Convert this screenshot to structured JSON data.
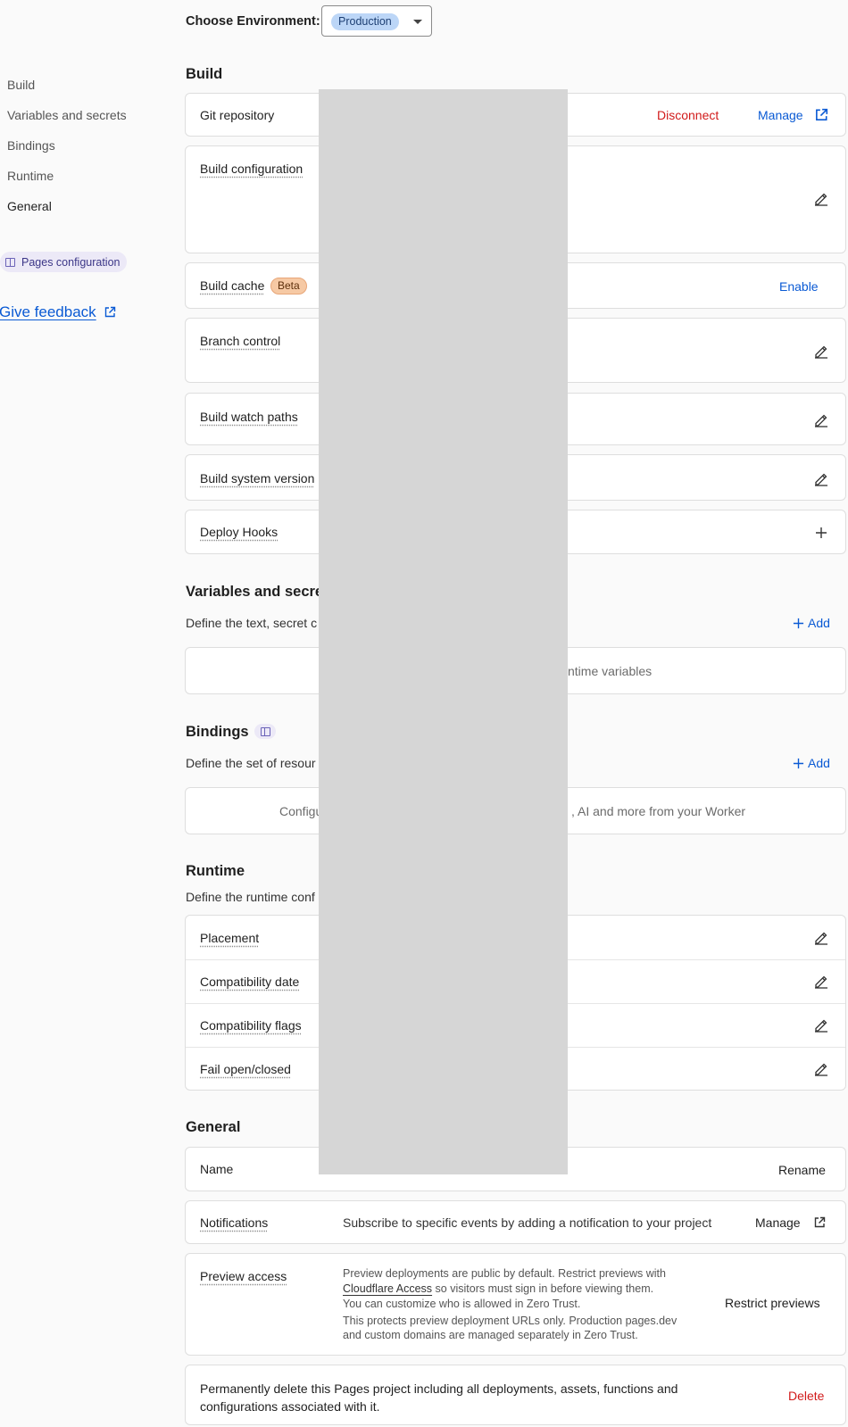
{
  "sidebar": {
    "items": [
      {
        "label": "Build"
      },
      {
        "label": "Variables and secrets"
      },
      {
        "label": "Bindings"
      },
      {
        "label": "Runtime"
      },
      {
        "label": "General"
      }
    ],
    "pages_config_label": "Pages configuration",
    "feedback_label": "Give feedback"
  },
  "environment": {
    "label": "Choose Environment:",
    "selected": "Production"
  },
  "build": {
    "title": "Build",
    "git_repository": {
      "label": "Git repository",
      "disconnect": "Disconnect",
      "manage": "Manage"
    },
    "build_configuration": {
      "label": "Build configuration"
    },
    "build_cache": {
      "label": "Build cache",
      "badge": "Beta",
      "action": "Enable"
    },
    "branch_control": {
      "label": "Branch control"
    },
    "build_watch_paths": {
      "label": "Build watch paths"
    },
    "build_system_version": {
      "label": "Build system version"
    },
    "deploy_hooks": {
      "label": "Deploy Hooks"
    }
  },
  "variables": {
    "title": "Variables and secret",
    "desc": "Define the text, secret c",
    "add": "Add",
    "empty": "ntime variables"
  },
  "bindings": {
    "title": "Bindings",
    "desc": "Define the set of resour",
    "add": "Add",
    "empty_left": "Configu",
    "empty_right": ", AI and more from your Worker"
  },
  "runtime": {
    "title": "Runtime",
    "desc": "Define the runtime conf",
    "rows": [
      {
        "label": "Placement"
      },
      {
        "label": "Compatibility date"
      },
      {
        "label": "Compatibility flags"
      },
      {
        "label": "Fail open/closed"
      }
    ]
  },
  "general": {
    "title": "General",
    "name": {
      "label": "Name",
      "action": "Rename"
    },
    "notifications": {
      "label": "Notifications",
      "desc": "Subscribe to specific events by adding a notification to your project",
      "action": "Manage"
    },
    "preview_access": {
      "label": "Preview access",
      "line1": "Preview deployments are public by default. Restrict previews with",
      "link": "Cloudflare Access",
      "line2_rest": " so visitors must sign in before viewing them.",
      "line3": "You can customize who is allowed in Zero Trust.",
      "line4": "This protects preview deployment URLs only. Production pages.dev",
      "line5": "and custom domains are managed separately in Zero Trust.",
      "action": "Restrict previews"
    },
    "delete": {
      "line1": "Permanently delete this Pages project including all deployments, assets, functions and",
      "line2": "configurations associated with it.",
      "action": "Delete"
    }
  }
}
